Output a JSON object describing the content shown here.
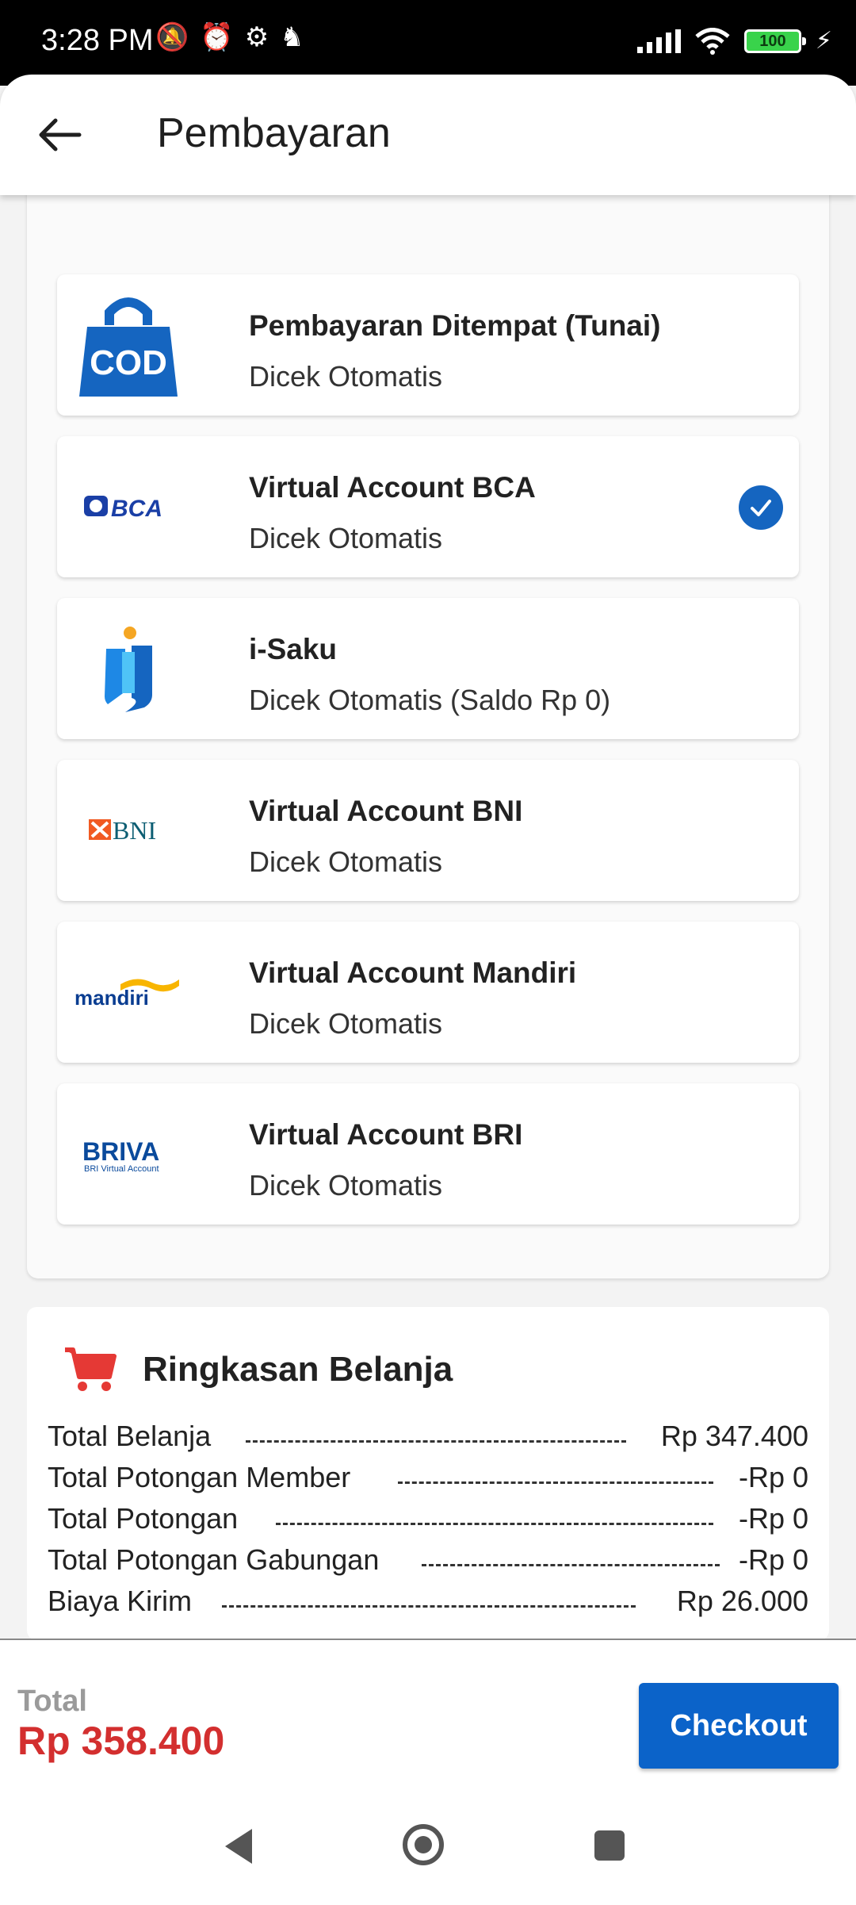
{
  "status_bar": {
    "time": "3:28 PM",
    "battery": "100"
  },
  "header": {
    "title": "Pembayaran"
  },
  "payment_methods": [
    {
      "name": "Pembayaran Ditempat (Tunai)",
      "sub": "Dicek Otomatis",
      "logo_text": "COD",
      "icon": "cod-bag-icon",
      "selected": false
    },
    {
      "name": "Virtual Account BCA",
      "sub": "Dicek Otomatis",
      "logo_text": "BCA",
      "icon": "bca-logo",
      "selected": true
    },
    {
      "name": "i-Saku",
      "sub": "Dicek Otomatis (Saldo Rp 0)",
      "logo_text": "",
      "icon": "isaku-logo",
      "selected": false
    },
    {
      "name": "Virtual Account BNI",
      "sub": "Dicek Otomatis",
      "logo_text": "BNI",
      "icon": "bni-logo",
      "selected": false
    },
    {
      "name": "Virtual Account Mandiri",
      "sub": "Dicek Otomatis",
      "logo_text": "mandiri",
      "icon": "mandiri-logo",
      "selected": false
    },
    {
      "name": "Virtual Account BRI",
      "sub": "Dicek Otomatis",
      "logo_text": "BRIVA",
      "logo_subtext": "BRI Virtual Account",
      "icon": "briva-logo",
      "selected": false
    }
  ],
  "summary": {
    "title": "Ringkasan Belanja",
    "rows": [
      {
        "label": "Total Belanja",
        "value": "Rp 347.400"
      },
      {
        "label": "Total Potongan Member",
        "value": "-Rp 0"
      },
      {
        "label": "Total Potongan",
        "value": "-Rp 0"
      },
      {
        "label": "Total Potongan Gabungan",
        "value": "-Rp 0"
      },
      {
        "label": "Biaya Kirim",
        "value": "Rp 26.000"
      }
    ]
  },
  "footer": {
    "total_label": "Total",
    "total_amount": "Rp 358.400",
    "checkout_label": "Checkout"
  },
  "colors": {
    "primary": "#0b63c9",
    "accent_red": "#d32f2f",
    "check_blue": "#1565c0"
  }
}
